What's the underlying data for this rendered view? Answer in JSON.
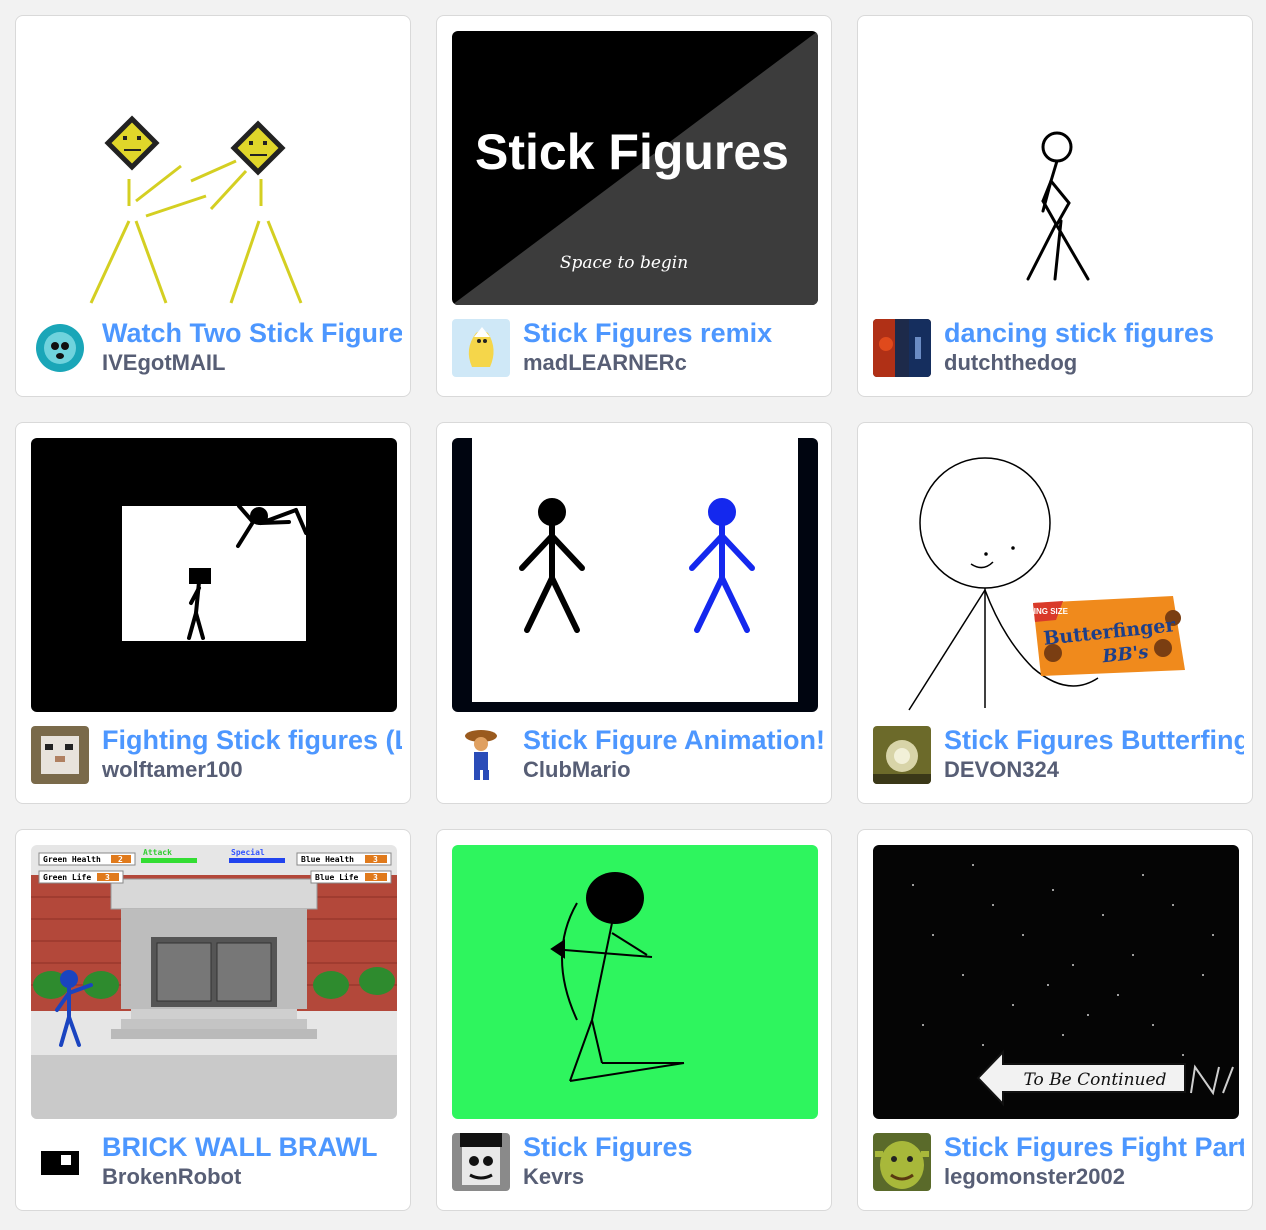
{
  "projects": [
    {
      "title": "Watch Two Stick Figure",
      "author": "IVEgotMAIL"
    },
    {
      "title": "Stick Figures remix",
      "author": "madLEARNERc",
      "thumb_title": "Stick Figures",
      "thumb_subtitle": "Space to begin"
    },
    {
      "title": "dancing stick figures",
      "author": "dutchthedog"
    },
    {
      "title": "Fighting Stick figures (L",
      "author": "wolftamer100"
    },
    {
      "title": "Stick Figure Animation!",
      "author": "ClubMario"
    },
    {
      "title": "Stick Figures Butterfing",
      "author": "DEVON324",
      "thumb_candy_top": "KING SIZE",
      "thumb_candy_brand": "Butterfinger",
      "thumb_candy_sub": "BB's"
    },
    {
      "title": "BRICK WALL BRAWL",
      "author": "BrokenRobot",
      "thumb_hud": {
        "green_health_label": "Green Health",
        "green_health": "2",
        "green_life_label": "Green Life",
        "green_life": "3",
        "blue_health_label": "Blue Health",
        "blue_health": "3",
        "blue_life_label": "Blue Life",
        "blue_life": "3",
        "attack": "Attack",
        "special": "Special"
      }
    },
    {
      "title": "Stick Figures",
      "author": "Kevrs"
    },
    {
      "title": "Stick Figures Fight Part",
      "author": "legomonster2002",
      "thumb_sign": "To Be Continued"
    }
  ],
  "colors": {
    "title": "#4d97ff",
    "author": "#575e75",
    "background": "#f2f2f2"
  }
}
